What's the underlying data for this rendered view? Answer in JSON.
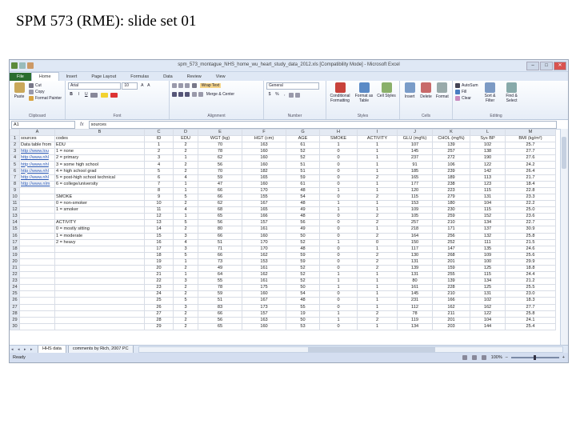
{
  "slide_title": "SPM 573 (RME): slide set 01",
  "excel": {
    "window_title": "spm_573_montague_NHS_home_wu_heart_study_data_2012.xls [Compatibility Mode] - Microsoft Excel",
    "win_buttons": {
      "minimize": "–",
      "maximize": "□",
      "close": "✕"
    },
    "tabs": [
      "File",
      "Home",
      "Insert",
      "Page Layout",
      "Formulas",
      "Data",
      "Review",
      "View"
    ],
    "ribbon": {
      "clipboard": {
        "paste": "Paste",
        "cut": "Cut",
        "copy": "Copy",
        "format_painter": "Format Painter",
        "label": "Clipboard"
      },
      "font": {
        "font_name": "Arial",
        "font_size": "10",
        "label": "Font",
        "bold": "B",
        "italic": "I",
        "underline": "U"
      },
      "alignment": {
        "wrap_text": "Wrap Text",
        "merge_center": "Merge & Center",
        "label": "Alignment"
      },
      "number": {
        "format": "General",
        "label": "Number",
        "currency": "$",
        "percent": "%",
        "comma": ","
      },
      "styles": {
        "conditional": "Conditional Formatting",
        "format_table": "Format as Table",
        "cell_styles": "Cell Styles",
        "label": "Styles"
      },
      "cells": {
        "insert": "Insert",
        "delete": "Delete",
        "format": "Format",
        "label": "Cells"
      },
      "editing": {
        "autosum": "AutoSum",
        "fill": "Fill",
        "clear": "Clear",
        "sort_filter": "Sort & Filter",
        "find_select": "Find & Select",
        "label": "Editing"
      }
    },
    "name_box": "A1",
    "formula_value": "sources",
    "columns": [
      "A",
      "B",
      "C",
      "D",
      "E",
      "F",
      "G",
      "H",
      "I",
      "J",
      "K",
      "L",
      "M"
    ],
    "rows": [
      [
        "sources",
        "codes",
        "ID",
        "EDU",
        "WGT (kg)",
        "HGT (cm)",
        "AGE",
        "SMOKE",
        "ACTIVITY",
        "GLU (mg%)",
        "CHOL (mg%)",
        "Sys BP",
        "BMI (kg/m²)"
      ],
      [
        "Data table from",
        "EDU",
        "1",
        "2",
        "70",
        "163",
        "61",
        "1",
        "1",
        "107",
        "139",
        "102",
        "25.7"
      ],
      [
        "http://www.lou",
        "1 = none",
        "2",
        "2",
        "78",
        "160",
        "52",
        "0",
        "1",
        "145",
        "257",
        "138",
        "27.7"
      ],
      [
        "http://www.nhl",
        "2 = primary",
        "3",
        "1",
        "62",
        "160",
        "52",
        "0",
        "1",
        "237",
        "272",
        "190",
        "27.6"
      ],
      [
        "http://www.nhl",
        "3 = some high school",
        "4",
        "2",
        "56",
        "160",
        "51",
        "0",
        "1",
        "91",
        "106",
        "122",
        "24.2"
      ],
      [
        "http://www.nhl",
        "4 = high school grad",
        "5",
        "2",
        "70",
        "182",
        "51",
        "0",
        "1",
        "185",
        "239",
        "142",
        "26.4"
      ],
      [
        "http://www.nhl",
        "5 = post-high school technical",
        "6",
        "4",
        "59",
        "165",
        "59",
        "0",
        "2",
        "165",
        "189",
        "113",
        "21.7"
      ],
      [
        "http://www.nlm",
        "6 = college/university",
        "7",
        "1",
        "47",
        "160",
        "61",
        "0",
        "1",
        "177",
        "238",
        "123",
        "18.4"
      ],
      [
        "",
        "",
        "8",
        "1",
        "66",
        "170",
        "48",
        "1",
        "1",
        "120",
        "223",
        "115",
        "22.8"
      ],
      [
        "",
        "SMOKE",
        "9",
        "5",
        "66",
        "155",
        "54",
        "0",
        "2",
        "115",
        "279",
        "131",
        "23.3"
      ],
      [
        "",
        "0 = non-smoker",
        "10",
        "2",
        "62",
        "167",
        "48",
        "1",
        "1",
        "153",
        "180",
        "104",
        "22.2"
      ],
      [
        "",
        "1 = smoker",
        "11",
        "4",
        "68",
        "165",
        "49",
        "1",
        "1",
        "109",
        "230",
        "115",
        "25.0"
      ],
      [
        "",
        "",
        "12",
        "1",
        "65",
        "166",
        "48",
        "0",
        "2",
        "105",
        "259",
        "152",
        "23.6"
      ],
      [
        "",
        "ACTIVITY",
        "13",
        "5",
        "56",
        "157",
        "56",
        "0",
        "2",
        "257",
        "210",
        "134",
        "22.7"
      ],
      [
        "",
        "0 = mostly sitting",
        "14",
        "2",
        "80",
        "161",
        "49",
        "0",
        "1",
        "218",
        "171",
        "137",
        "30.9"
      ],
      [
        "",
        "1 = moderate",
        "15",
        "3",
        "66",
        "160",
        "50",
        "0",
        "2",
        "164",
        "256",
        "132",
        "25.8"
      ],
      [
        "",
        "2 = heavy",
        "16",
        "4",
        "51",
        "170",
        "52",
        "1",
        "0",
        "150",
        "252",
        "111",
        "21.5"
      ],
      [
        "",
        "",
        "17",
        "3",
        "71",
        "170",
        "48",
        "0",
        "1",
        "117",
        "147",
        "135",
        "24.6"
      ],
      [
        "",
        "",
        "18",
        "5",
        "66",
        "162",
        "59",
        "0",
        "2",
        "130",
        "268",
        "109",
        "25.6"
      ],
      [
        "",
        "",
        "19",
        "1",
        "73",
        "153",
        "59",
        "0",
        "2",
        "131",
        "201",
        "100",
        "29.9"
      ],
      [
        "",
        "",
        "20",
        "2",
        "49",
        "161",
        "52",
        "0",
        "2",
        "139",
        "159",
        "125",
        "18.8"
      ],
      [
        "",
        "",
        "21",
        "1",
        "64",
        "162",
        "52",
        "1",
        "1",
        "131",
        "255",
        "115",
        "24.4"
      ],
      [
        "",
        "",
        "22",
        "3",
        "55",
        "161",
        "52",
        "1",
        "1",
        "80",
        "139",
        "134",
        "21.2"
      ],
      [
        "",
        "",
        "23",
        "2",
        "78",
        "175",
        "50",
        "1",
        "1",
        "161",
        "228",
        "125",
        "25.5"
      ],
      [
        "",
        "",
        "24",
        "2",
        "59",
        "160",
        "54",
        "0",
        "1",
        "145",
        "210",
        "131",
        "23.0"
      ],
      [
        "",
        "",
        "25",
        "5",
        "51",
        "167",
        "48",
        "0",
        "1",
        "231",
        "166",
        "102",
        "18.3"
      ],
      [
        "",
        "",
        "26",
        "3",
        "83",
        "173",
        "55",
        "0",
        "1",
        "112",
        "162",
        "162",
        "27.7"
      ],
      [
        "",
        "",
        "27",
        "2",
        "66",
        "157",
        "19",
        "1",
        "2",
        "78",
        "211",
        "122",
        "25.8"
      ],
      [
        "",
        "",
        "28",
        "2",
        "56",
        "163",
        "50",
        "1",
        "2",
        "119",
        "201",
        "104",
        "24.1"
      ],
      [
        "",
        "",
        "29",
        "2",
        "65",
        "160",
        "53",
        "0",
        "1",
        "134",
        "203",
        "144",
        "25.4"
      ]
    ],
    "sheet_tabs": [
      "HHS data",
      "comments by Rich, 2007 PC"
    ],
    "status_left": "Ready",
    "zoom": "100%"
  }
}
